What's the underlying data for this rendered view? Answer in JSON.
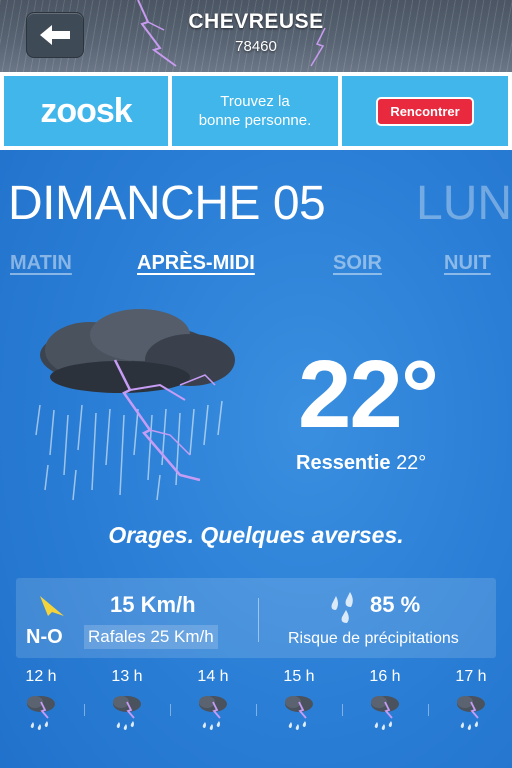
{
  "header": {
    "back_icon": "back-arrow-icon",
    "city": "CHEVREUSE",
    "zip": "78460"
  },
  "ad": {
    "logo": "zoosk",
    "tagline_line1": "Trouvez la",
    "tagline_line2": "bonne personne.",
    "cta": "Rencontrer"
  },
  "days": {
    "current": "DIMANCHE 05",
    "next": "LUN"
  },
  "tabs": [
    {
      "label": "MATIN",
      "active": false
    },
    {
      "label": "APRÈS-MIDI",
      "active": true
    },
    {
      "label": "SOIR",
      "active": false
    },
    {
      "label": "NUIT",
      "active": false
    }
  ],
  "current": {
    "icon": "thunderstorm-icon",
    "temp": "22°",
    "feels_label": "Ressentie",
    "feels_value": "22°",
    "description": "Orages. Quelques averses."
  },
  "stats": {
    "wind_speed": "15 Km/h",
    "wind_dir": "N-O",
    "gusts": "Rafales 25 Km/h",
    "rain_pct": "85 %",
    "rain_label": "Risque de précipitations"
  },
  "hourly": [
    {
      "time": "12 h",
      "icon": "thunderstorm-rain-icon"
    },
    {
      "time": "13 h",
      "icon": "thunderstorm-rain-icon"
    },
    {
      "time": "14 h",
      "icon": "thunderstorm-rain-icon"
    },
    {
      "time": "15 h",
      "icon": "thunderstorm-rain-icon"
    },
    {
      "time": "16 h",
      "icon": "thunderstorm-rain-icon"
    },
    {
      "time": "17 h",
      "icon": "thunderstorm-rain-icon"
    }
  ],
  "colors": {
    "background": "#2b7fd6",
    "ad_blue": "#40b6ea",
    "ad_button": "#e8293e",
    "lightning": "#b47be8",
    "wind_arrow": "#f5d33a"
  }
}
